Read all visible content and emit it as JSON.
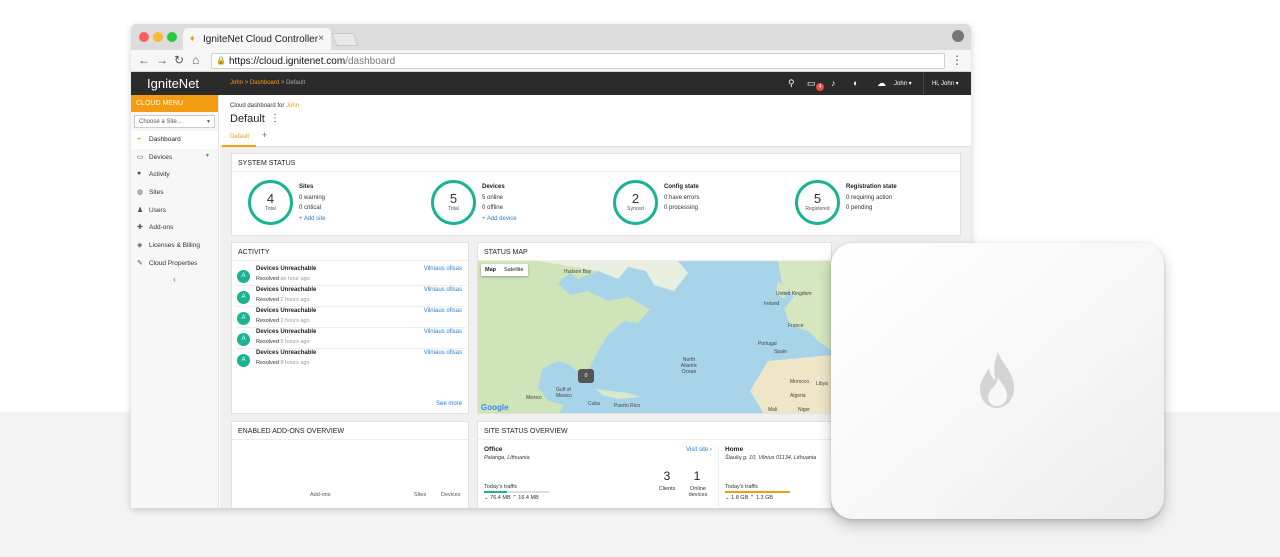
{
  "browser": {
    "tab_title": "IgniteNet Cloud Controller",
    "url_host": "https://cloud.ignitenet.com",
    "url_path": "/dashboard"
  },
  "topbar": {
    "logo": "IgniteNet",
    "breadcrumb": [
      "John",
      ">",
      "Dashboard",
      ">",
      "Default"
    ],
    "notification_count": "4",
    "user": "John",
    "greeting": "Hi, John"
  },
  "sidebar": {
    "menu_title": "CLOUD MENU",
    "site_select": "Choose a Site...",
    "items": [
      {
        "label": "Dashboard",
        "icon": "dashboard-icon"
      },
      {
        "label": "Devices",
        "icon": "devices-icon"
      },
      {
        "label": "Activity",
        "icon": "activity-icon"
      },
      {
        "label": "Sites",
        "icon": "sites-icon"
      },
      {
        "label": "Users",
        "icon": "users-icon"
      },
      {
        "label": "Add-ons",
        "icon": "puzzle-icon"
      },
      {
        "label": "Licenses & Billing",
        "icon": "tag-icon"
      },
      {
        "label": "Cloud Properties",
        "icon": "edit-icon"
      }
    ]
  },
  "page": {
    "subtitle_prefix": "Cloud dashboard for",
    "subtitle_user": "John",
    "title": "Default",
    "tab": "Default"
  },
  "system_status": {
    "title": "SYSTEM STATUS",
    "stats": [
      {
        "num": "4",
        "unit": "Total",
        "heading": "Sites",
        "lines": [
          "0 warning",
          "0 critical"
        ],
        "link": "+ Add site"
      },
      {
        "num": "5",
        "unit": "Total",
        "heading": "Devices",
        "lines": [
          "5 online",
          "0 offline"
        ],
        "link": "+ Add device"
      },
      {
        "num": "2",
        "unit": "Synced",
        "heading": "Config state",
        "lines": [
          "0 have errors",
          "0 processing"
        ],
        "link": ""
      },
      {
        "num": "5",
        "unit": "Registered",
        "heading": "Registration state",
        "lines": [
          "0 requiring action",
          "0 pending"
        ],
        "link": ""
      }
    ]
  },
  "activity": {
    "title": "ACTIVITY",
    "see_more": "See more",
    "items": [
      {
        "avatar": "A",
        "title": "Devices Unreachable",
        "status": "Resolved",
        "time": "an hour ago",
        "link": "Vilniaus ofisas"
      },
      {
        "avatar": "A",
        "title": "Devices Unreachable",
        "status": "Resolved",
        "time": "2 hours ago",
        "link": "Vilniaus ofisas"
      },
      {
        "avatar": "A",
        "title": "Devices Unreachable",
        "status": "Resolved",
        "time": "2 hours ago",
        "link": "Vilniaus ofisas"
      },
      {
        "avatar": "A",
        "title": "Devices Unreachable",
        "status": "Resolved",
        "time": "5 hours ago",
        "link": "Vilniaus ofisas"
      },
      {
        "avatar": "A",
        "title": "Devices Unreachable",
        "status": "Resolved",
        "time": "8 hours ago",
        "link": "Vilniaus ofisas"
      }
    ]
  },
  "status_map": {
    "title": "STATUS MAP",
    "map_btn": "Map",
    "sat_btn": "Satellite",
    "pin": "0",
    "google": "Google",
    "labels": [
      "Hudson Bay",
      "United Kingdom",
      "Ireland",
      "France",
      "Spain",
      "Portugal",
      "North Atlantic Ocean",
      "Gulf of Mexico",
      "Mexico",
      "Cuba",
      "Puerto Rico",
      "Morocco",
      "Algeria",
      "Mali",
      "Niger",
      "Libya"
    ]
  },
  "addons": {
    "title": "ENABLED ADD-ONS OVERVIEW",
    "col_addons": "Add-ons",
    "col_sites": "Sites",
    "col_devices": "Devices"
  },
  "site_overview": {
    "title": "SITE STATUS OVERVIEW",
    "office": {
      "name": "Office",
      "address": "Palanga, Lithuania",
      "link": "Visit site ›",
      "traffic_label": "Today's traffic",
      "traffic": "⌄ 76.4 MB ⌃ 16.4 MB",
      "clients": "3",
      "clients_label": "Clients",
      "online": "1",
      "online_label": "Online devices",
      "bar_color": "#1ab394",
      "bar_level": 0.35
    },
    "home": {
      "name": "Home",
      "address": "Šiaulių g. 10, Vilnius 01134, Lithuania",
      "traffic_label": "Today's traffic",
      "traffic": "⌄ 1.8 GB ⌃ 1.3 GB",
      "bar_color": "#f39c12",
      "bar_level": 1.0
    }
  },
  "colors": {
    "accent": "#f39c12",
    "teal": "#1ab394",
    "link": "#2a7fd4",
    "topbar": "#2b2b2b"
  }
}
